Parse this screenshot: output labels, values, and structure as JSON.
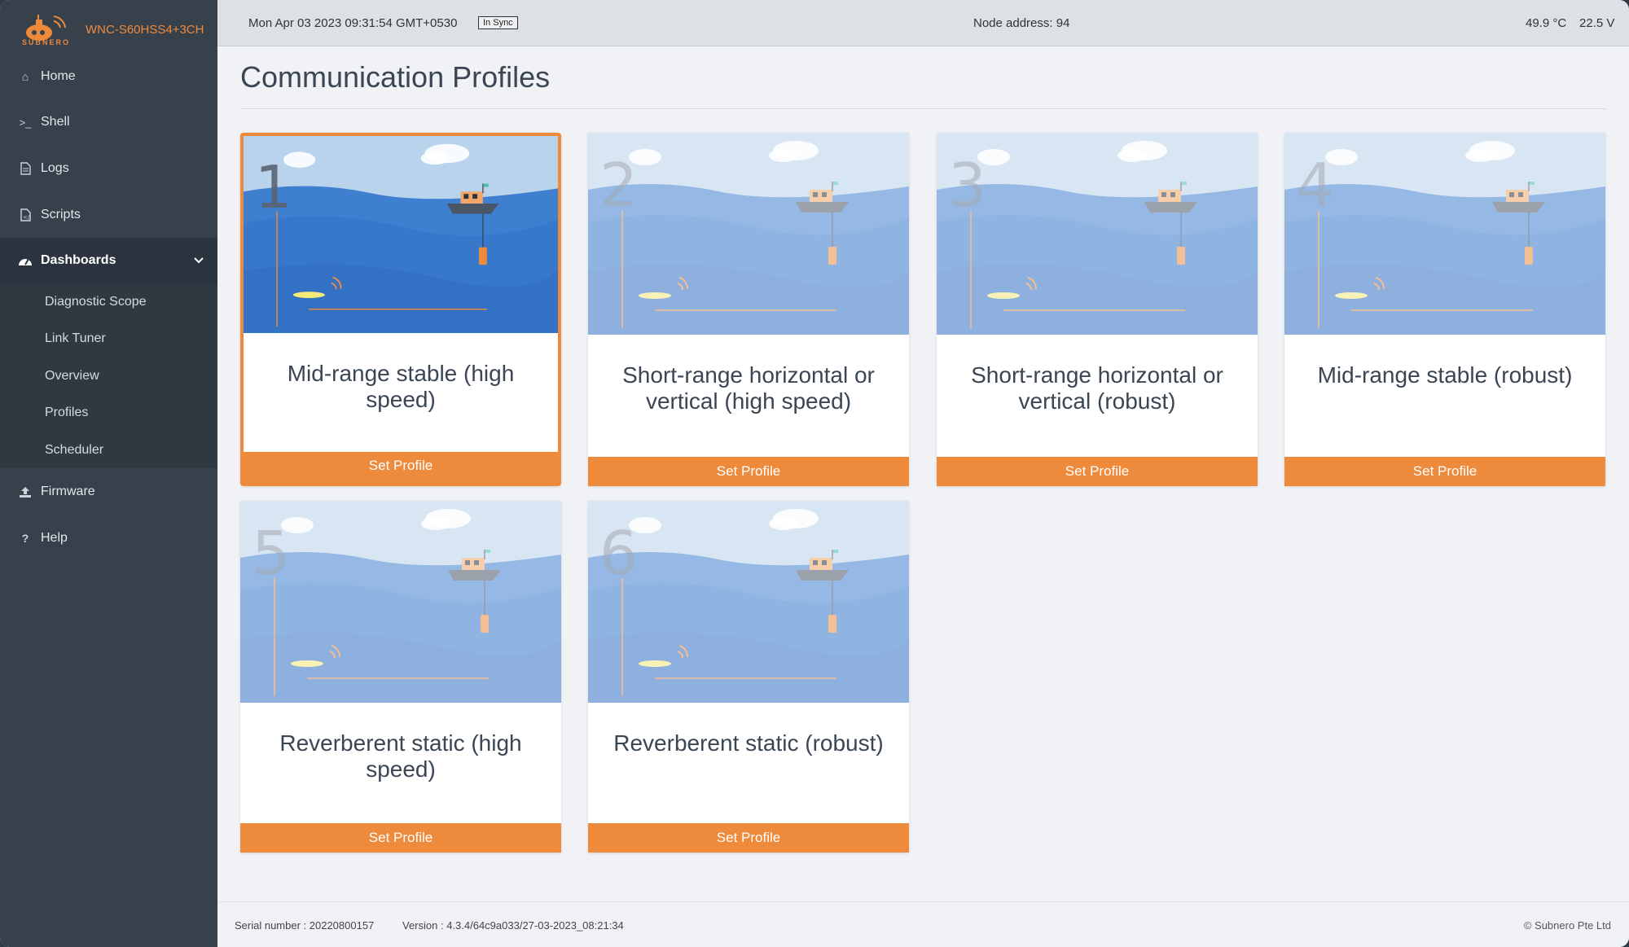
{
  "brand": {
    "logo_text": "SUBNERO",
    "device_name": "WNC-S60HSS4+3CH"
  },
  "sidebar": {
    "items": [
      {
        "label": "Home",
        "icon": "home-icon"
      },
      {
        "label": "Shell",
        "icon": "terminal-icon"
      },
      {
        "label": "Logs",
        "icon": "file-icon"
      },
      {
        "label": "Scripts",
        "icon": "script-file-icon"
      },
      {
        "label": "Dashboards",
        "icon": "dashboard-gauge-icon",
        "expanded": true
      },
      {
        "label": "Firmware",
        "icon": "upload-icon"
      },
      {
        "label": "Help",
        "icon": "question-icon"
      }
    ],
    "dashboards_sub": [
      {
        "label": "Diagnostic Scope"
      },
      {
        "label": "Link Tuner"
      },
      {
        "label": "Overview"
      },
      {
        "label": "Profiles"
      },
      {
        "label": "Scheduler"
      }
    ]
  },
  "header": {
    "datetime": "Mon Apr 03 2023 09:31:54 GMT+0530",
    "sync_status": "In Sync",
    "node_address": "Node address: 94",
    "temperature": "49.9 °C",
    "voltage": "22.5 V"
  },
  "main": {
    "title": "Communication Profiles",
    "profiles": [
      {
        "number": "1",
        "name": "Mid-range stable (high speed)",
        "button": "Set Profile",
        "selected": true
      },
      {
        "number": "2",
        "name": "Short-range horizontal or vertical (high speed)",
        "button": "Set Profile",
        "selected": false
      },
      {
        "number": "3",
        "name": "Short-range horizontal or vertical (robust)",
        "button": "Set Profile",
        "selected": false
      },
      {
        "number": "4",
        "name": "Mid-range stable (robust)",
        "button": "Set Profile",
        "selected": false
      },
      {
        "number": "5",
        "name": "Reverberent static (high speed)",
        "button": "Set Profile",
        "selected": false
      },
      {
        "number": "6",
        "name": "Reverberent static (robust)",
        "button": "Set Profile",
        "selected": false
      }
    ]
  },
  "footer": {
    "serial": "Serial number : 20220800157",
    "version": "Version : 4.3.4/64c9a033/27-03-2023_08:21:34",
    "copyright": "© Subnero Pte Ltd"
  },
  "colors": {
    "accent": "#ee8a3c",
    "sidebar": "#37414c",
    "sea": "#3f7fd0"
  }
}
